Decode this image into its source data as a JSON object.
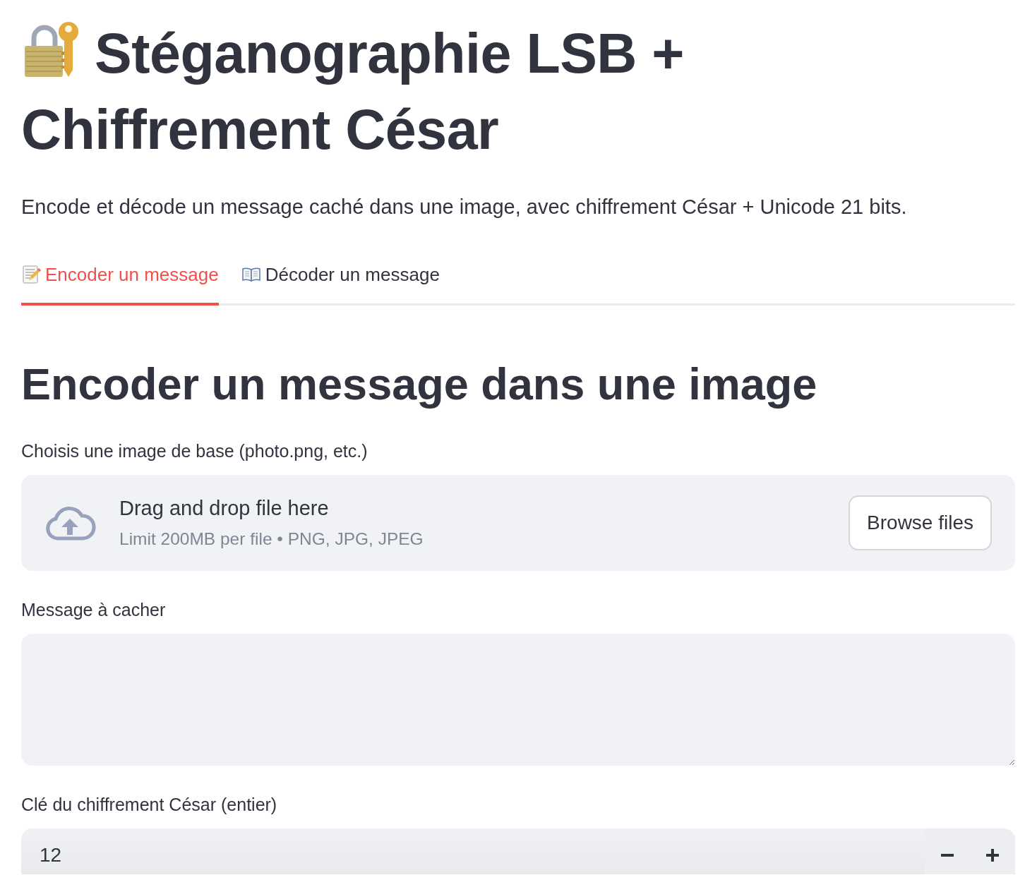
{
  "title_lines": [
    "Stéganographie LSB +",
    "Chiffrement César"
  ],
  "subtitle": "Encode et décode un message caché dans une image, avec chiffrement César + Unicode 21 bits.",
  "tabs": [
    {
      "label": "Encoder un message",
      "selected": true
    },
    {
      "label": "Décoder un message",
      "selected": false
    }
  ],
  "panel": {
    "heading": "Encoder un message dans une image",
    "fields": [
      {
        "kind": "file_uploader",
        "label": "Choisis une image de base (photo.png, etc.)",
        "prompt": "Drag and drop file here",
        "hint": "Limit 200MB per file • PNG, JPG, JPEG",
        "button": "Browse files"
      },
      {
        "kind": "textarea",
        "label": "Message à cacher"
      },
      {
        "kind": "number",
        "label": "Clé du chiffrement César (entier)",
        "value": "12"
      }
    ]
  }
}
